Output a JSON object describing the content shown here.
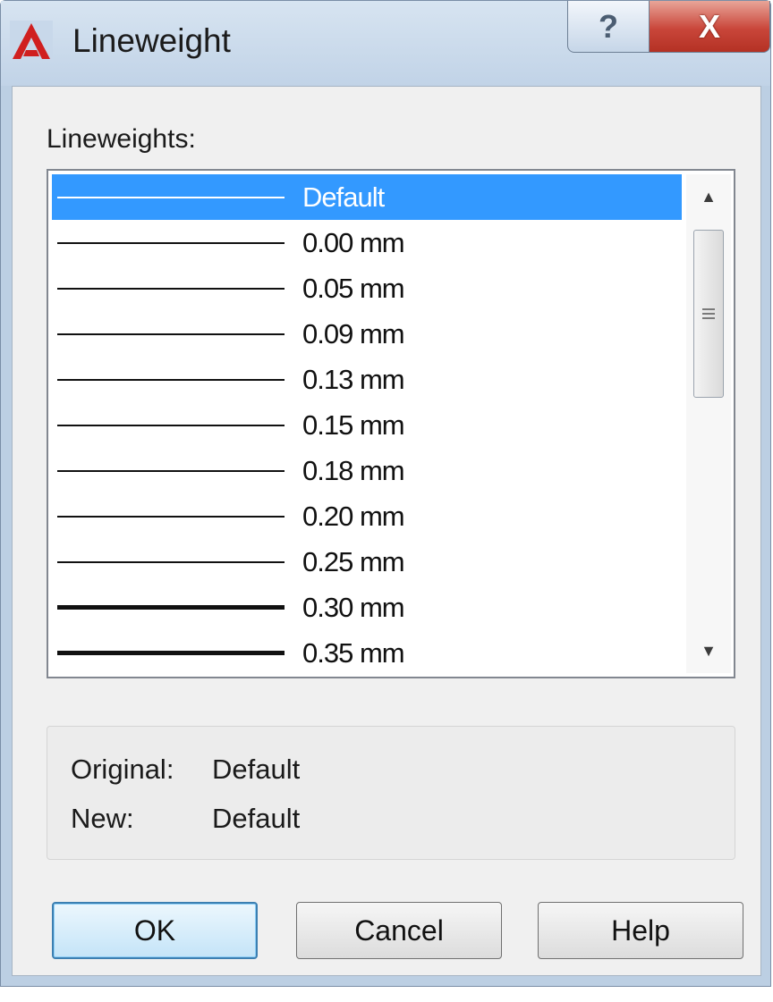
{
  "window": {
    "title": "Lineweight",
    "help_label": "?",
    "close_label": "X"
  },
  "list": {
    "label": "Lineweights:",
    "selected_index": 0,
    "items": [
      {
        "label": "Default",
        "weight": "hairline"
      },
      {
        "label": "0.00 mm",
        "weight": "thin"
      },
      {
        "label": "0.05 mm",
        "weight": "thin"
      },
      {
        "label": "0.09 mm",
        "weight": "thin"
      },
      {
        "label": "0.13 mm",
        "weight": "thin"
      },
      {
        "label": "0.15 mm",
        "weight": "thin"
      },
      {
        "label": "0.18 mm",
        "weight": "thin"
      },
      {
        "label": "0.20 mm",
        "weight": "thin"
      },
      {
        "label": "0.25 mm",
        "weight": "thin"
      },
      {
        "label": "0.30 mm",
        "weight": "thick"
      },
      {
        "label": "0.35 mm",
        "weight": "thick"
      }
    ],
    "scroll_fraction": 0
  },
  "info": {
    "original_label": "Original:",
    "original_value": "Default",
    "new_label": "New:",
    "new_value": "Default"
  },
  "buttons": {
    "ok": "OK",
    "cancel": "Cancel",
    "help": "Help"
  },
  "colors": {
    "selection": "#3399ff",
    "close_button": "#c9463a",
    "app_icon": "#d01f1f"
  }
}
